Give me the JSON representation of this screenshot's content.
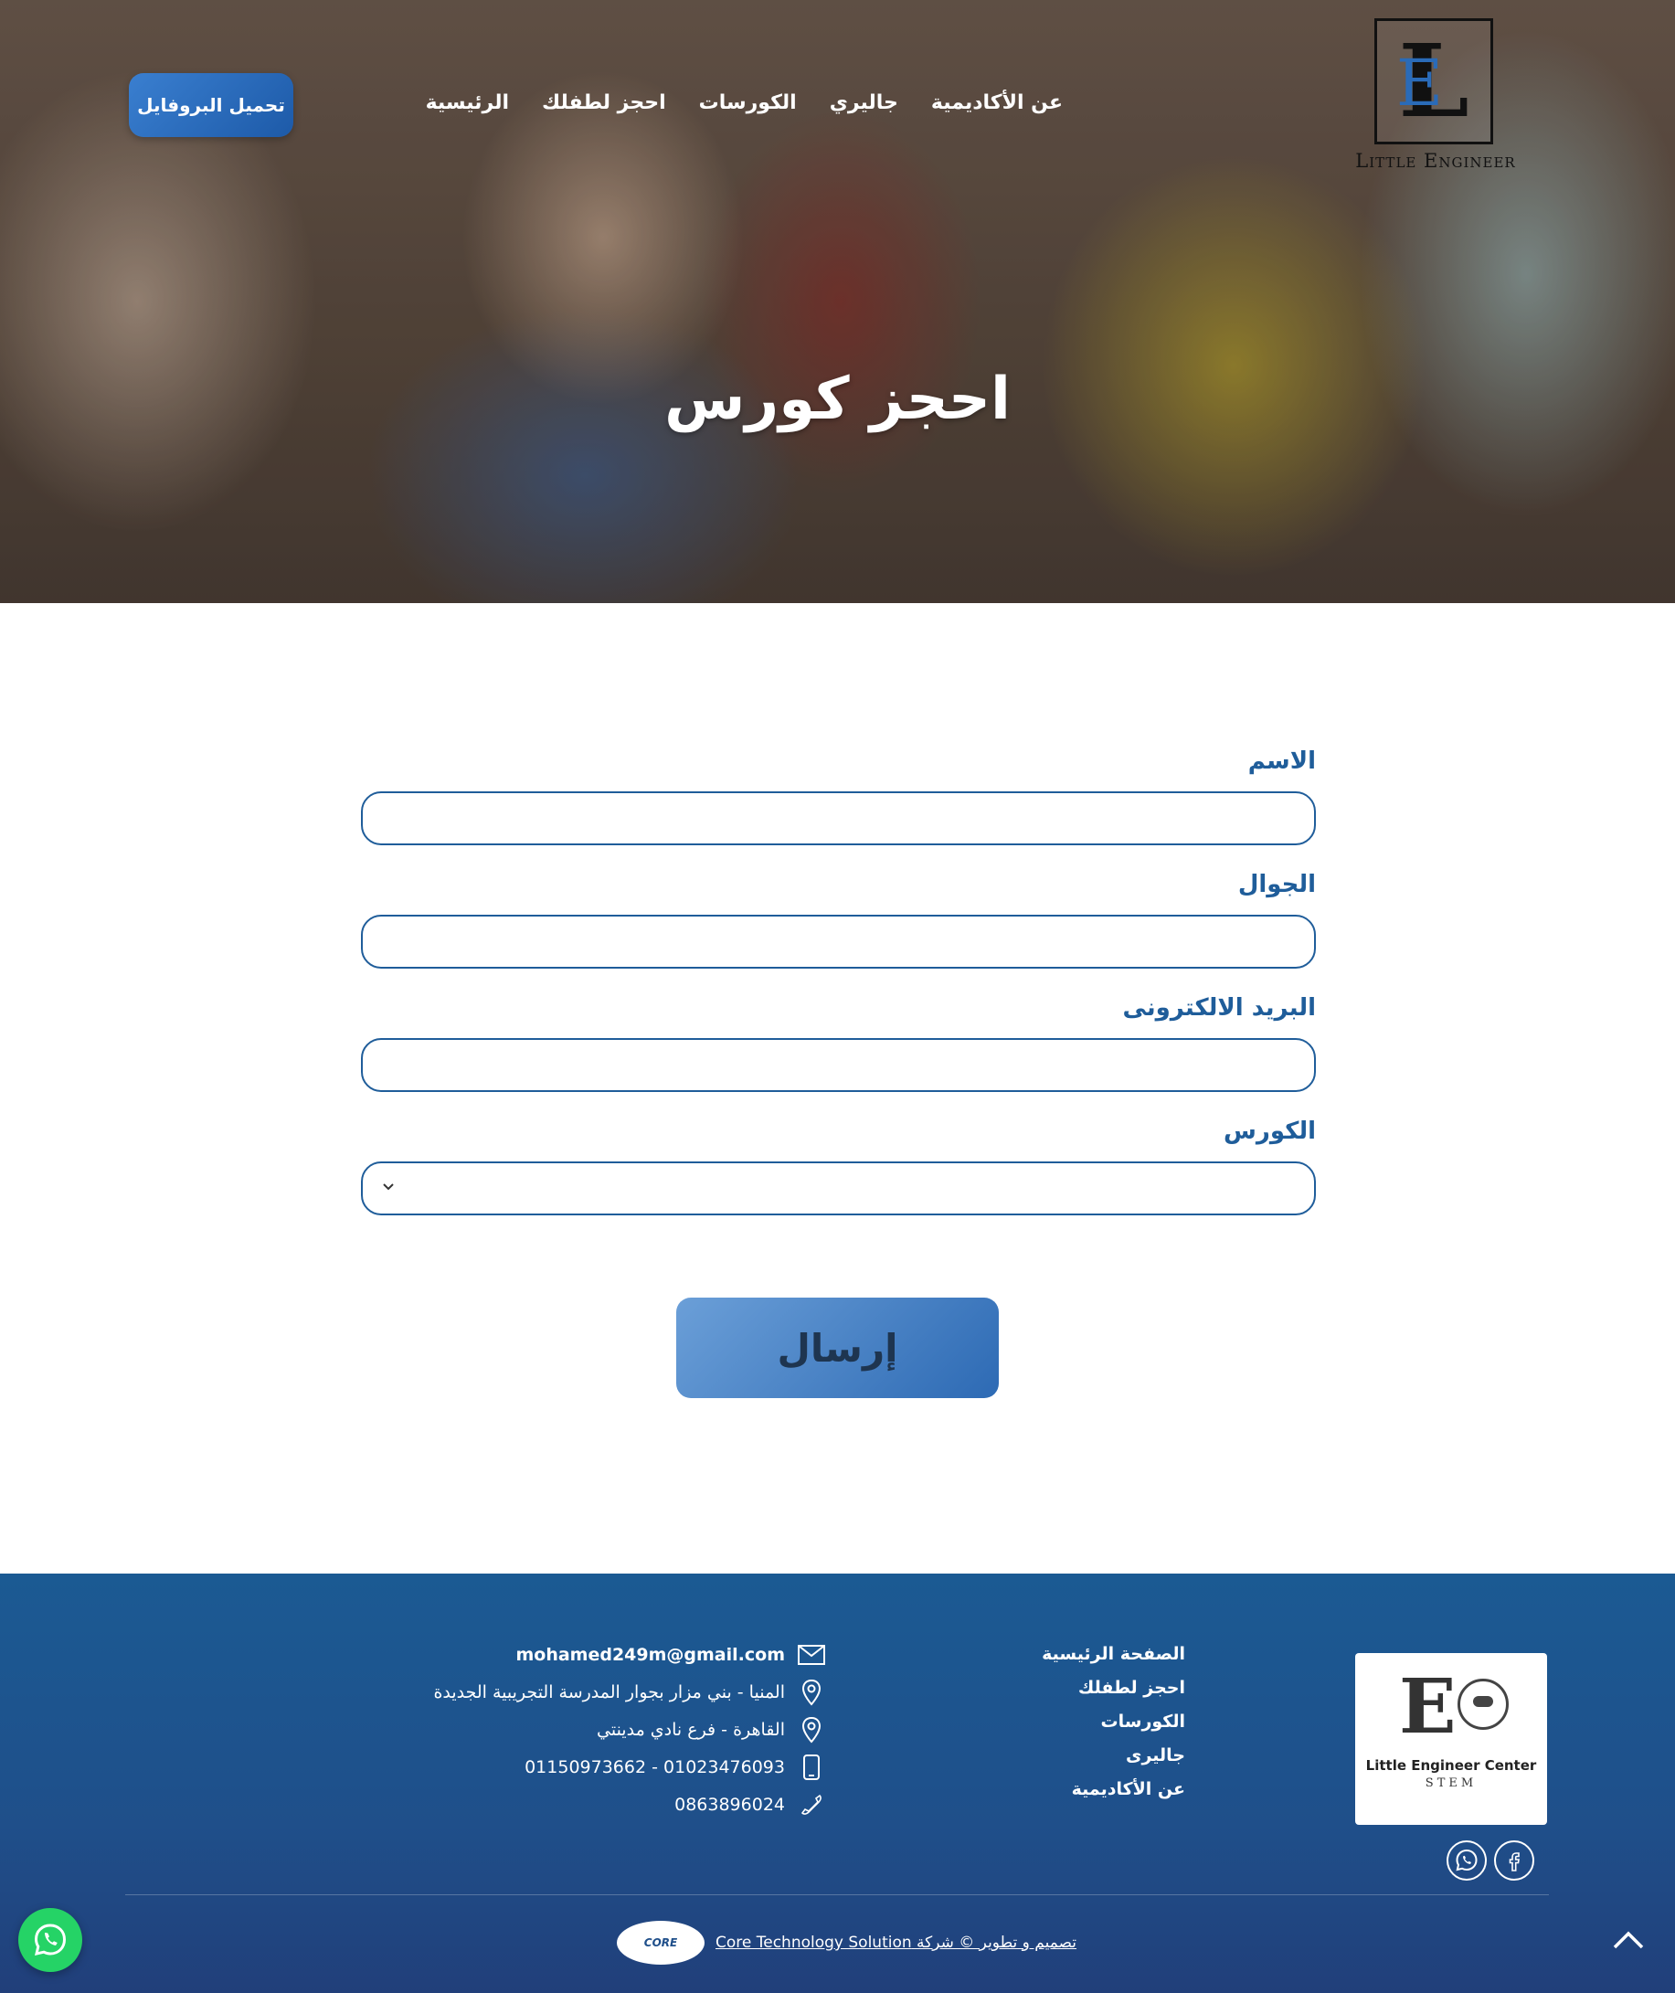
{
  "header": {
    "profile_button": "تحميل البروفايل",
    "nav": [
      "الرئيسية",
      "احجز لطفلك",
      "الكورسات",
      "جاليري",
      "عن الأكاديمية"
    ],
    "logo": {
      "letter": "L",
      "accent_letter": "E",
      "text": "Little Engineer"
    }
  },
  "hero": {
    "title": "احجز كورس"
  },
  "form": {
    "name_label": "الاسم",
    "name_value": "",
    "phone_label": "الجوال",
    "phone_value": "",
    "email_label": "البريد الالكترونى",
    "email_value": "",
    "course_label": "الكورس",
    "course_selected": "",
    "submit_label": "إرسال"
  },
  "footer": {
    "logo": {
      "name": "Little Engineer Center",
      "subtitle": "STEM"
    },
    "links": [
      "الصفحة الرئيسية",
      "احجز لطفلك",
      "الكورسات",
      "جاليرى",
      "عن الأكاديمية"
    ],
    "contact": {
      "email": "mohamed249m@gmail.com",
      "address_1": "المنيا - بني مزار بجوار المدرسة التجريبية الجديدة",
      "address_2": "القاهرة - فرع نادي مدينتي",
      "mobile": "01023476093 - 01150973662",
      "phone": "0863896024"
    },
    "credit": "تصميم و تطوير © شركة Core Technology Solution",
    "credit_logo": "CORE"
  },
  "icons": [
    "mail-icon",
    "location-icon",
    "mobile-icon",
    "phone-icon",
    "whatsapp-icon",
    "facebook-icon",
    "chevron-up-icon",
    "chevron-down-icon"
  ],
  "colors": {
    "primary": "#1f5d9a",
    "footer_bg": "#1f4f8a",
    "button": "#2d6ab4",
    "whatsapp": "#25d366"
  }
}
